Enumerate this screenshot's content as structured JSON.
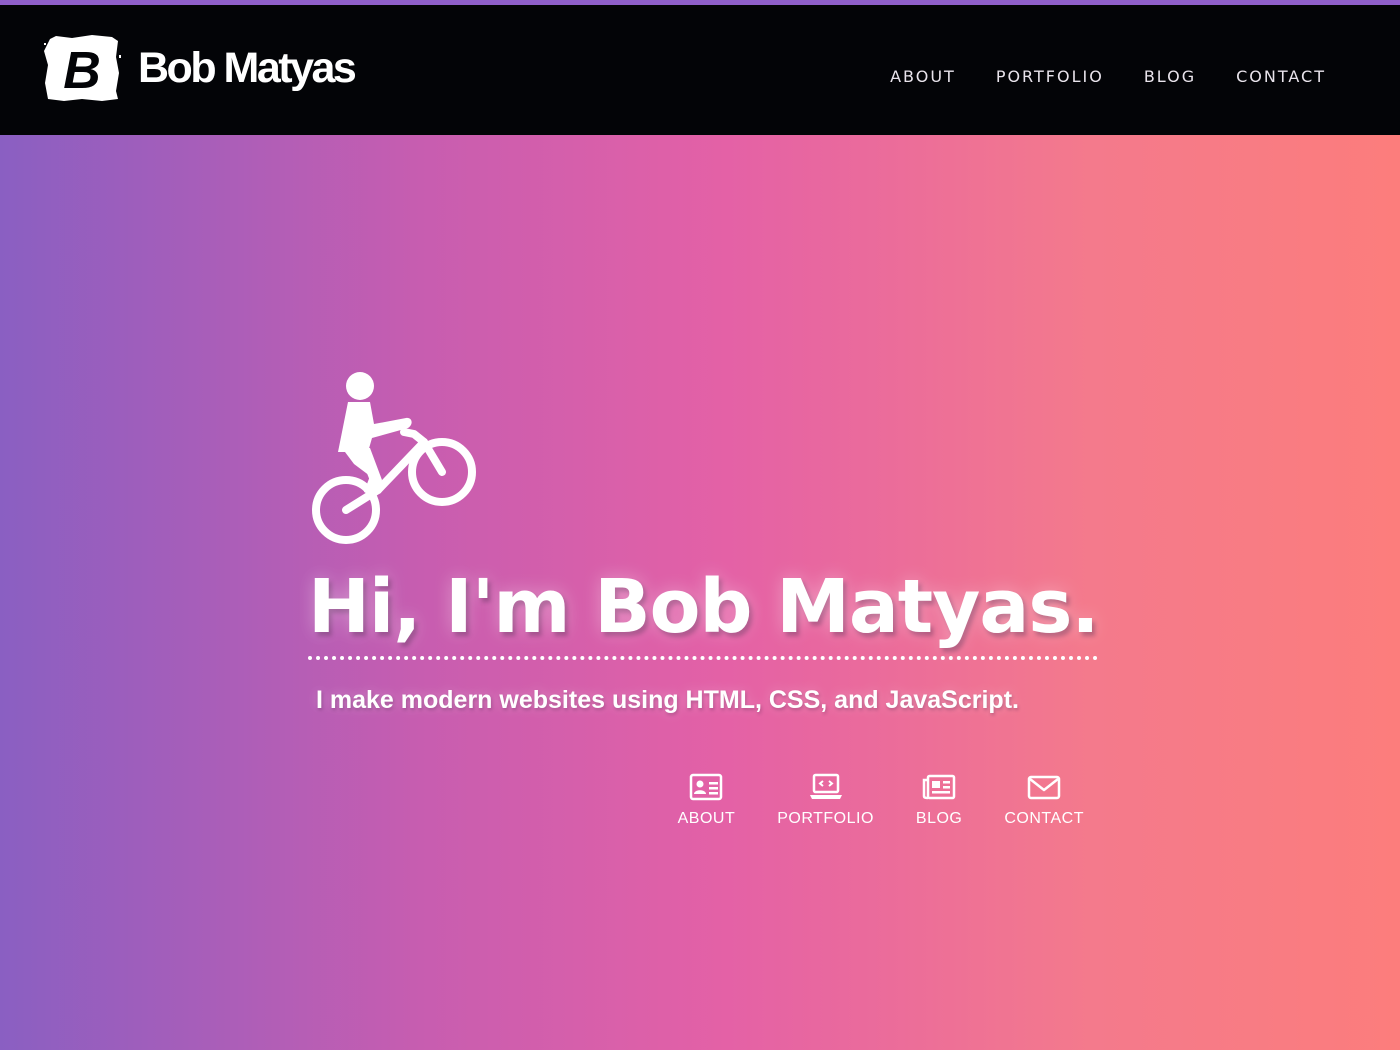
{
  "header": {
    "logo_letter": "B",
    "brand_name": "Bob Matyas",
    "nav": [
      {
        "label": "ABOUT"
      },
      {
        "label": "PORTFOLIO"
      },
      {
        "label": "BLOG"
      },
      {
        "label": "CONTACT"
      }
    ]
  },
  "hero": {
    "title": "Hi, I'm Bob Matyas.",
    "subtitle": "I make modern websites using HTML, CSS, and JavaScript.",
    "icon": "cyclist-icon"
  },
  "quick_links": [
    {
      "label": "ABOUT",
      "icon": "id-card-icon"
    },
    {
      "label": "PORTFOLIO",
      "icon": "laptop-code-icon"
    },
    {
      "label": "BLOG",
      "icon": "newspaper-icon"
    },
    {
      "label": "CONTACT",
      "icon": "envelope-icon"
    }
  ],
  "colors": {
    "header_bg": "#030407",
    "accent_bar": "#8f5fc9",
    "gradient_left": "#8a5fc2",
    "gradient_mid": "#e461a6",
    "gradient_right": "#fc7d7c"
  }
}
